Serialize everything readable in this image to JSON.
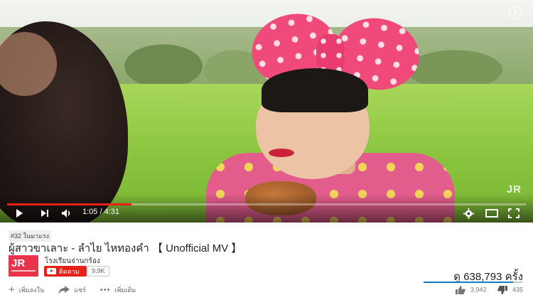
{
  "player": {
    "watermark": "JR",
    "info_icon": "i",
    "time": "1:05 / 4:31",
    "progress": 0.24,
    "icons": [
      "play-icon",
      "next-icon",
      "volume-icon",
      "settings-icon",
      "theater-icon",
      "fullscreen-icon"
    ]
  },
  "video": {
    "rank_badge": "#32 ในมาแรง",
    "title": "ผู้สาวขาเลาะ - ลำไย ไหทองคำ 【 Unofficial MV 】"
  },
  "channel": {
    "avatar_text": "JR",
    "name": "โรงเรียนจ่านกร้อง",
    "subscribe_label": "ติดตาม",
    "subscriber_count": "9.9K"
  },
  "stats": {
    "views": "ดู 638,793 ครั้ง",
    "likes": "3,942",
    "dislikes": "435",
    "like_ratio": 0.9
  },
  "actions": {
    "add_label": "เพิ่มลงใน",
    "share_label": "แชร์",
    "more_label": "เพิ่มเติม"
  }
}
